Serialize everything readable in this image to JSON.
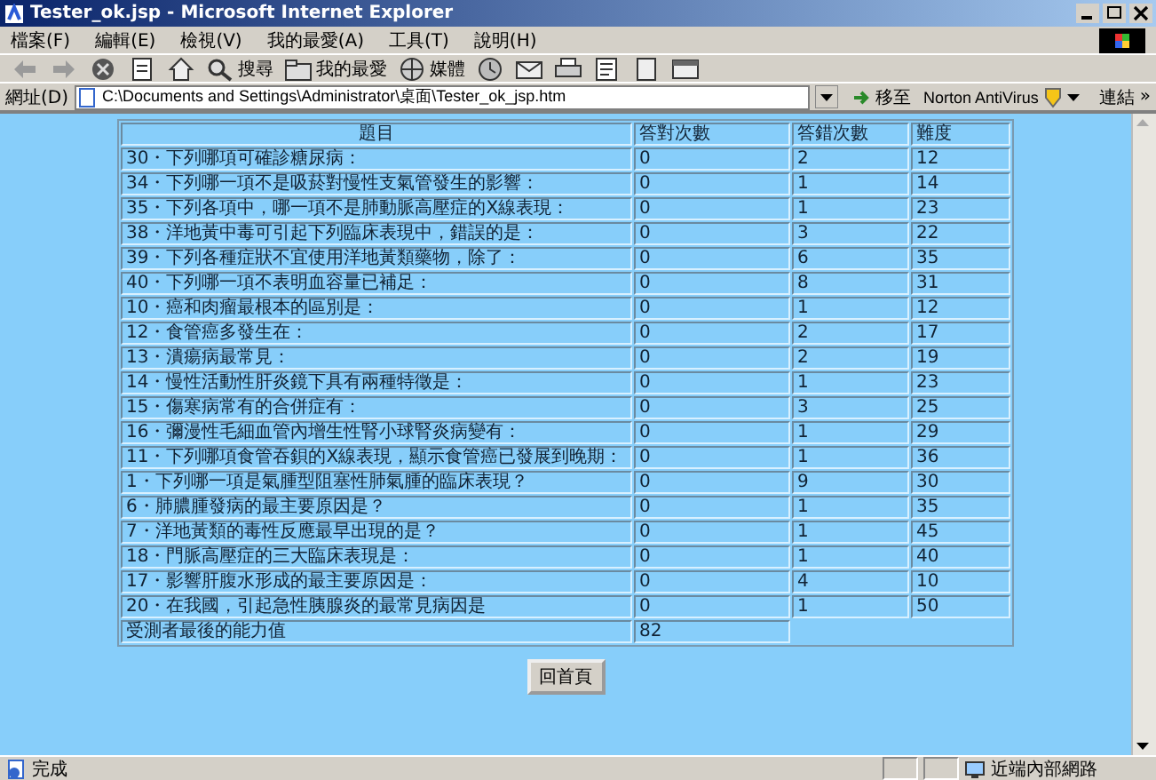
{
  "window": {
    "title": "Tester_ok.jsp - Microsoft Internet Explorer"
  },
  "menu": [
    "檔案(F)",
    "編輯(E)",
    "檢視(V)",
    "我的最愛(A)",
    "工具(T)",
    "說明(H)"
  ],
  "toolbar": [
    {
      "kind": "back"
    },
    {
      "kind": "forward"
    },
    {
      "kind": "stop"
    },
    {
      "kind": "refresh"
    },
    {
      "kind": "home"
    },
    {
      "kind": "search",
      "label": "搜尋"
    },
    {
      "kind": "favorites",
      "label": "我的最愛"
    },
    {
      "kind": "media",
      "label": "媒體"
    },
    {
      "kind": "history"
    },
    {
      "kind": "mail"
    },
    {
      "kind": "print"
    },
    {
      "kind": "edit"
    },
    {
      "kind": "discuss"
    },
    {
      "kind": "messenger"
    }
  ],
  "address_bar": {
    "label": "網址(D)",
    "value": "C:\\Documents and Settings\\Administrator\\桌面\\Tester_ok_jsp.htm",
    "go": "移至",
    "plugin": "Norton AntiVirus",
    "links": "連結",
    "more": "»"
  },
  "table": {
    "columns": [
      "題目",
      "答對次數",
      "答錯次數",
      "難度"
    ],
    "rows": [
      {
        "question": "30・下列哪項可確診糖尿病：",
        "correct": "0",
        "wrong": "2",
        "difficulty": "12"
      },
      {
        "question": "34・下列哪一項不是吸菸對慢性支氣管發生的影響：",
        "correct": "0",
        "wrong": "1",
        "difficulty": "14"
      },
      {
        "question": "35・下列各項中，哪一項不是肺動脈高壓症的X線表現：",
        "correct": "0",
        "wrong": "1",
        "difficulty": "23"
      },
      {
        "question": "38・洋地黃中毒可引起下列臨床表現中，錯誤的是：",
        "correct": "0",
        "wrong": "3",
        "difficulty": "22"
      },
      {
        "question": "39・下列各種症狀不宜使用洋地黃類藥物，除了：",
        "correct": "0",
        "wrong": "6",
        "difficulty": "35"
      },
      {
        "question": "40・下列哪一項不表明血容量已補足：",
        "correct": "0",
        "wrong": "8",
        "difficulty": "31"
      },
      {
        "question": "10・癌和肉瘤最根本的區別是：",
        "correct": "0",
        "wrong": "1",
        "difficulty": "12"
      },
      {
        "question": "12・食管癌多發生在：",
        "correct": "0",
        "wrong": "2",
        "difficulty": "17"
      },
      {
        "question": "13・潰瘍病最常見：",
        "correct": "0",
        "wrong": "2",
        "difficulty": "19"
      },
      {
        "question": "14・慢性活動性肝炎鏡下具有兩種特徵是：",
        "correct": "0",
        "wrong": "1",
        "difficulty": "23"
      },
      {
        "question": "15・傷寒病常有的合併症有：",
        "correct": "0",
        "wrong": "3",
        "difficulty": "25"
      },
      {
        "question": "16・彌漫性毛細血管內增生性腎小球腎炎病變有：",
        "correct": "0",
        "wrong": "1",
        "difficulty": "29"
      },
      {
        "question": "11・下列哪項食管吞鋇的X線表現，顯示食管癌已發展到晚期：",
        "correct": "0",
        "wrong": "1",
        "difficulty": "36"
      },
      {
        "question": "1・下列哪一項是氣腫型阻塞性肺氣腫的臨床表現？",
        "correct": "0",
        "wrong": "9",
        "difficulty": "30"
      },
      {
        "question": "6・肺膿腫發病的最主要原因是？",
        "correct": "0",
        "wrong": "1",
        "difficulty": "35"
      },
      {
        "question": "7・洋地黃類的毒性反應最早出現的是？",
        "correct": "0",
        "wrong": "1",
        "difficulty": "45"
      },
      {
        "question": "18・門脈高壓症的三大臨床表現是：",
        "correct": "0",
        "wrong": "1",
        "difficulty": "40"
      },
      {
        "question": "17・影響肝腹水形成的最主要原因是：",
        "correct": "0",
        "wrong": "4",
        "difficulty": "10"
      },
      {
        "question": "20・在我國，引起急性胰腺炎的最常見病因是",
        "correct": "0",
        "wrong": "1",
        "difficulty": "50"
      }
    ],
    "result": {
      "label": "受測者最後的能力值",
      "value": "82"
    }
  },
  "home_button": "回首頁",
  "status_bar": {
    "text": "完成",
    "zone": "近端內部網路"
  }
}
